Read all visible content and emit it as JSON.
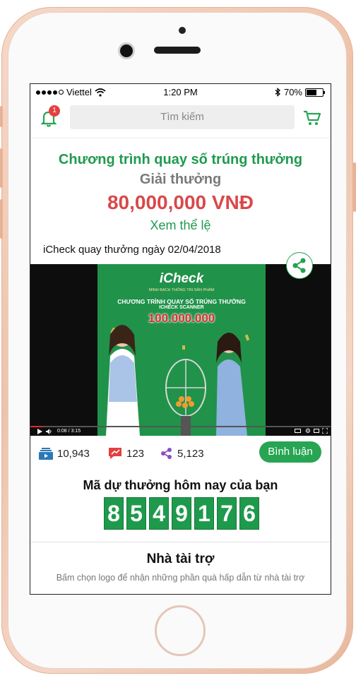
{
  "status_bar": {
    "carrier": "Viettel",
    "time": "1:20 PM",
    "battery_label": "70%",
    "battery_level_percent": 70
  },
  "header": {
    "notification_count": "1",
    "search_placeholder": "Tìm kiếm"
  },
  "promo": {
    "title": "Chương trình quay số trúng thưởng",
    "prize_label": "Giải thưởng",
    "prize_amount": "80,000,000 VNĐ",
    "rules_link": "Xem thể lệ"
  },
  "video": {
    "title": "iCheck quay thưởng ngày 02/04/2018",
    "poster_logo": "iCheck",
    "poster_tagline": "MINH BẠCH THÔNG TIN SẢN PHẨM",
    "poster_heading": "CHƯƠNG TRÌNH QUAY SỐ TRÚNG THƯỞNG",
    "poster_subheading": "ICHECK SCANNER",
    "poster_amount": "100.000.000",
    "time_display": "0:08 / 3:15"
  },
  "stats": {
    "views": "10,943",
    "reactions": "123",
    "shares": "5,123",
    "comment_button": "Bình luận"
  },
  "lucky_code": {
    "title": "Mã dự thưởng hôm nay của bạn",
    "digits": [
      "8",
      "5",
      "4",
      "9",
      "1",
      "7",
      "6"
    ]
  },
  "sponsors": {
    "title": "Nhà tài trợ",
    "subtitle": "Bấm chọn logo để nhận những phần quà hấp dẫn từ nhà tài trợ"
  },
  "colors": {
    "brand_green": "#1f9a4e",
    "prize_red": "#d9484a",
    "badge_red": "#e3403e"
  }
}
